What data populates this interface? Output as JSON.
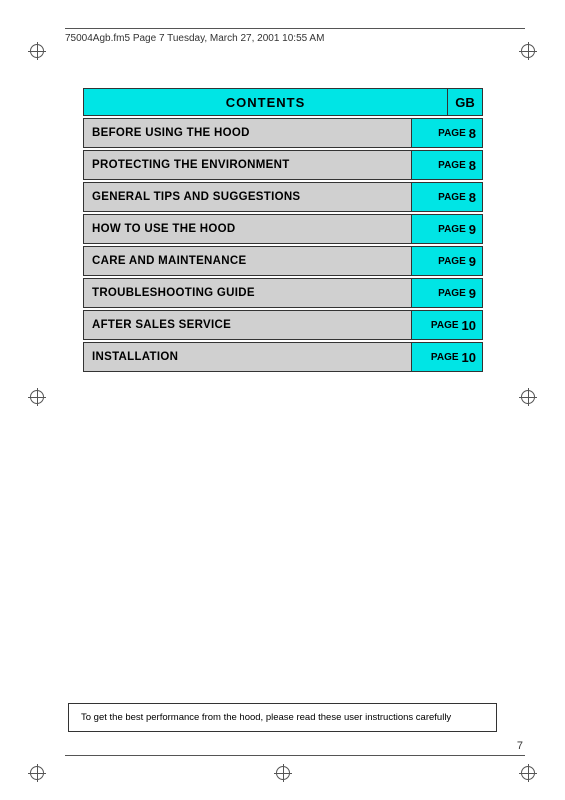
{
  "header": {
    "filename": "75004Agb.fm5  Page 7  Tuesday, March 27, 2001  10:55 AM"
  },
  "contents": {
    "title": "CONTENTS",
    "gb_label": "GB"
  },
  "toc_rows": [
    {
      "label": "BEFORE USING THE HOOD",
      "page_word": "PAGE",
      "page_num": "8"
    },
    {
      "label": "PROTECTING THE ENVIRONMENT",
      "page_word": "PAGE",
      "page_num": "8"
    },
    {
      "label": "GENERAL TIPS AND SUGGESTIONS",
      "page_word": "PAGE",
      "page_num": "8"
    },
    {
      "label": "HOW TO USE THE HOOD",
      "page_word": "PAGE",
      "page_num": "9"
    },
    {
      "label": "CARE AND MAINTENANCE",
      "page_word": "PAGE",
      "page_num": "9"
    },
    {
      "label": "TROUBLESHOOTING GUIDE",
      "page_word": "PAGE",
      "page_num": "9"
    },
    {
      "label": "AFTER SALES SERVICE",
      "page_word": "PAGE",
      "page_num": "10"
    },
    {
      "label": "INSTALLATION",
      "page_word": "PAGE",
      "page_num": "10"
    }
  ],
  "footer": {
    "note": "To get the best performance from the hood, please read these user instructions carefully"
  },
  "page_number": "7"
}
